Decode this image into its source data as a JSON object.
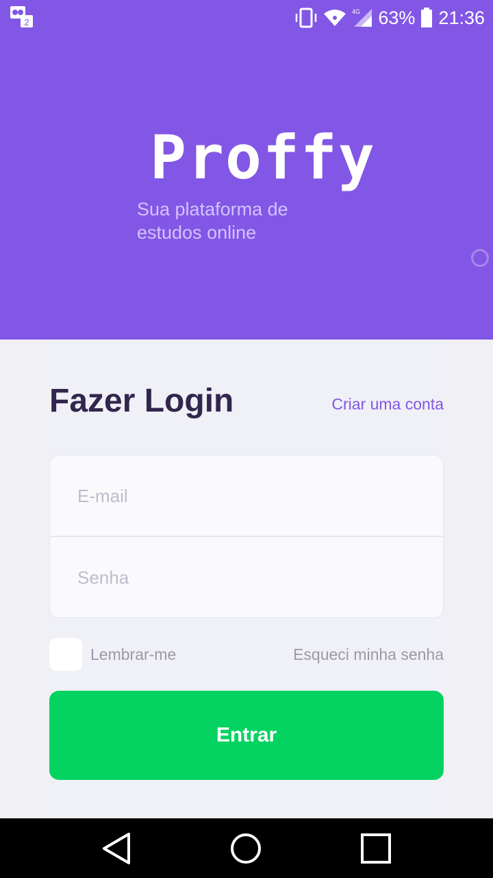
{
  "status_bar": {
    "notification_icon": "chat-notification-icon",
    "signal": "4G",
    "battery": "63%",
    "time": "21:36"
  },
  "hero": {
    "logo": "Proffy",
    "tagline": "Sua plataforma de estudos online"
  },
  "login": {
    "title": "Fazer Login",
    "create_account": "Criar uma conta",
    "email_placeholder": "E-mail",
    "password_placeholder": "Senha",
    "remember_me": "Lembrar-me",
    "forgot_password": "Esqueci minha senha",
    "submit": "Entrar"
  },
  "colors": {
    "brand": "#8257e5",
    "title": "#32264d",
    "success": "#04d361",
    "muted": "#9c98a6"
  }
}
